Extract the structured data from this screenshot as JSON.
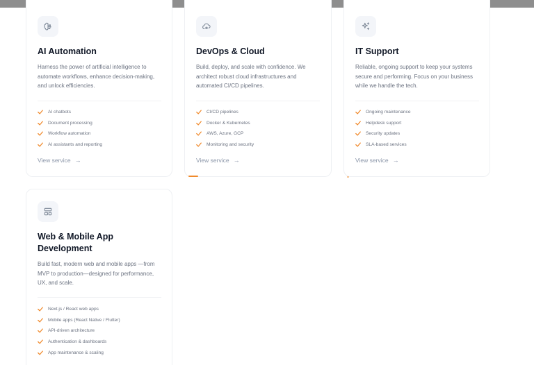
{
  "colors": {
    "accent": "#f08a2c",
    "topbar": "#8e8e8e",
    "icon_stroke": "#7c8796"
  },
  "services": [
    {
      "icon": "brain-icon",
      "title": "AI Automation",
      "description": "Harness the power of artificial intelligence to automate workflows, enhance decision-making, and unlock efficiencies.",
      "features": [
        "AI chatbots",
        "Document processing",
        "Workflow automation",
        "AI assistants and reporting"
      ],
      "link": "View service"
    },
    {
      "icon": "cloud-gear-icon",
      "title": "DevOps & Cloud",
      "description": "Build, deploy, and scale with confidence. We architect robust cloud infrastructures and automated CI/CD pipelines.",
      "features": [
        "CI/CD pipelines",
        "Docker & Kubernetes",
        "AWS, Azure, GCP",
        "Monitoring and security"
      ],
      "link": "View service"
    },
    {
      "icon": "sparkles-icon",
      "title": "IT Support",
      "description": "Reliable, ongoing support to keep your systems secure and performing. Focus on your business while we handle the tech.",
      "features": [
        "Ongoing maintenance",
        "Helpdesk support",
        "Security updates",
        "SLA-based services"
      ],
      "link": "View service"
    },
    {
      "icon": "layout-icon",
      "title": "Web & Mobile App Development",
      "description": "Build fast, modern web and mobile apps —from MVP to production—designed for performance, UX, and scale.",
      "features": [
        "Next.js / React web apps",
        "Mobile apps (React Native / Flutter)",
        "API-driven architecture",
        "Authentication & dashboards",
        "App maintenance & scaling"
      ]
    }
  ]
}
